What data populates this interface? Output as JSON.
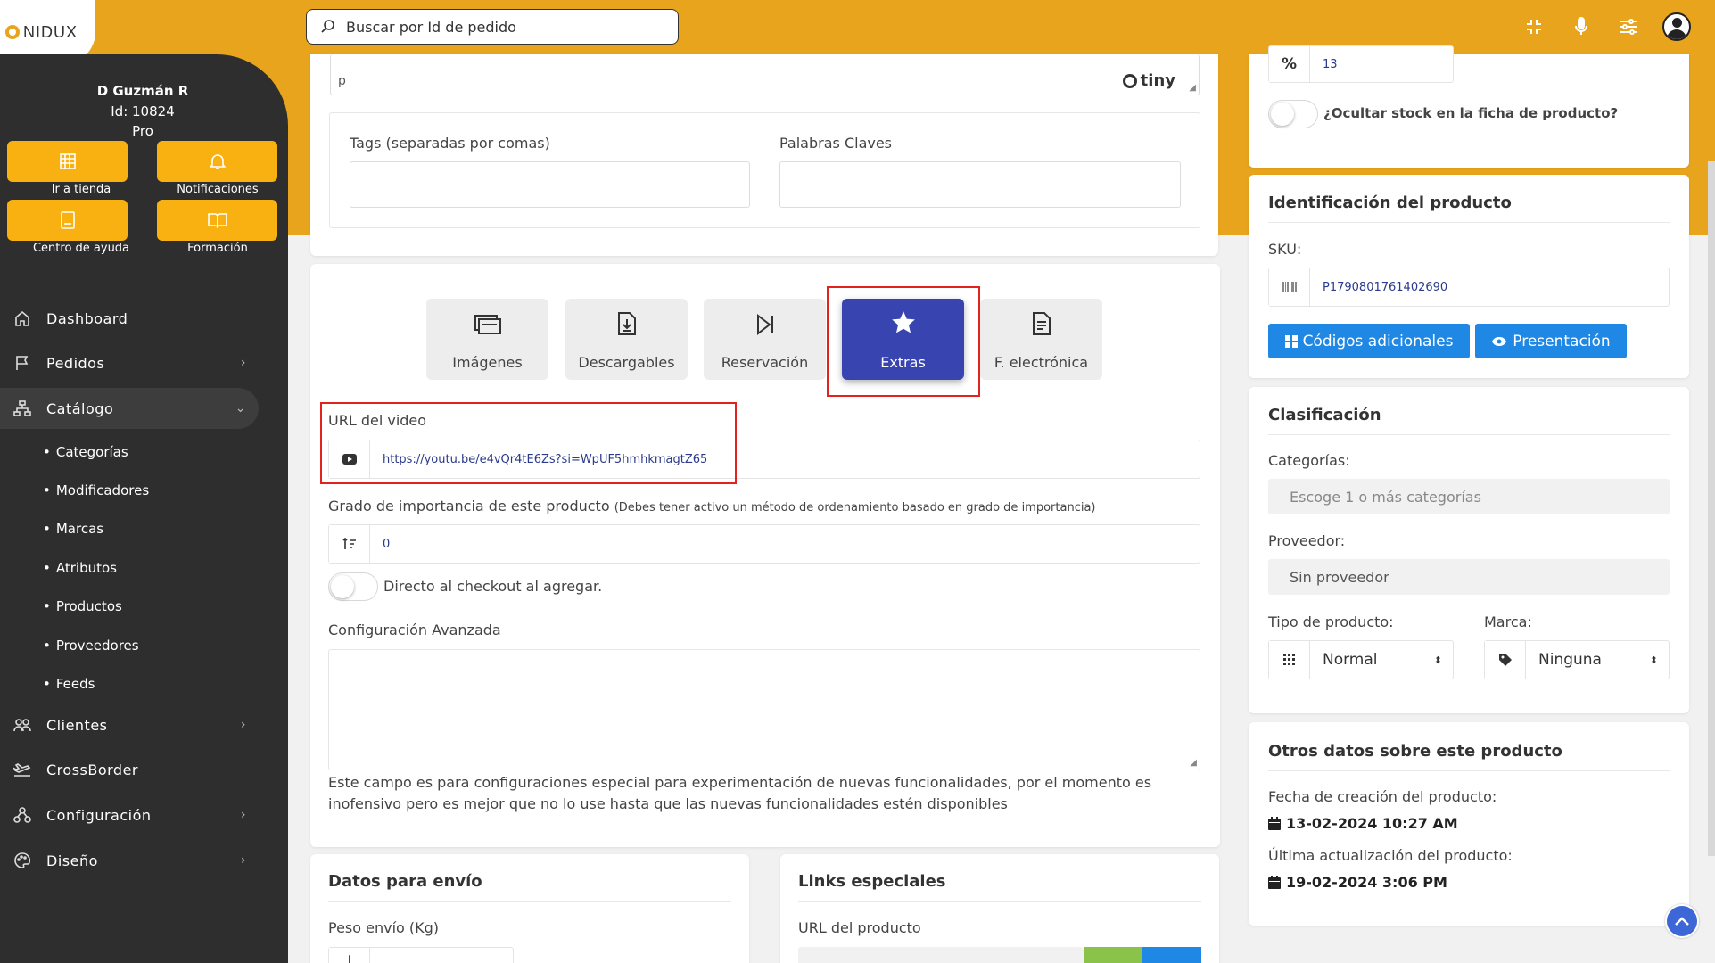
{
  "search": {
    "placeholder": "Buscar por Id de pedido"
  },
  "logo": {
    "text": "NIDUX"
  },
  "user": {
    "name": "D Guzmán R",
    "id": "Id: 10824",
    "plan": "Pro"
  },
  "quick_actions": [
    {
      "label": "Ir a tienda",
      "icon": "store-icon"
    },
    {
      "label": "Notificaciones",
      "icon": "bell-icon"
    },
    {
      "label": "Centro de ayuda",
      "icon": "book-icon"
    },
    {
      "label": "Formación",
      "icon": "open-book-icon"
    }
  ],
  "nav": {
    "dashboard": "Dashboard",
    "pedidos": "Pedidos",
    "catalogo": "Catálogo",
    "clientes": "Clientes",
    "crossborder": "CrossBorder",
    "configuracion": "Configuración",
    "diseno": "Diseño"
  },
  "catalog_sub": [
    "Categorías",
    "Modificadores",
    "Marcas",
    "Atributos",
    "Productos",
    "Proveedores",
    "Feeds"
  ],
  "editor": {
    "status": "p",
    "brand": "tiny"
  },
  "tags": {
    "tags_label": "Tags (separadas por comas)",
    "keywords_label": "Palabras Claves"
  },
  "tabs": [
    "Imágenes",
    "Descargables",
    "Reservación",
    "Extras",
    "F. electrónica"
  ],
  "extras": {
    "video_label": "URL del video",
    "video_value": "https://youtu.be/e4vQr4tE6Zs?si=WpUF5hmhkmagtZ65",
    "importance_label": "Grado de importancia de este producto",
    "importance_note": "(Debes tener activo un método de ordenamiento basado en grado de importancia)",
    "importance_value": "0",
    "checkout_label": "Directo al checkout al agregar.",
    "advanced_label": "Configuración Avanzada",
    "advanced_help": "Este campo es para configuraciones especial para experimentación de nuevas funcionalidades, por el momento es inofensivo pero es mejor que no lo use hasta que las nuevas funcionalidades estén disponibles"
  },
  "shipping": {
    "title": "Datos para envío",
    "weight_label": "Peso envío (Kg)"
  },
  "links": {
    "title": "Links especiales",
    "url_label": "URL del producto"
  },
  "stock": {
    "percent_symbol": "%",
    "percent_value": "13",
    "hide_stock_label": "¿Ocultar stock en la ficha de producto?"
  },
  "identification": {
    "title": "Identificación del producto",
    "sku_label": "SKU:",
    "sku_value": "P1790801761402690",
    "codes_button": "Códigos adicionales",
    "presentation_button": "Presentación"
  },
  "classification": {
    "title": "Clasificación",
    "categories_label": "Categorías:",
    "categories_placeholder": "Escoge 1 o más categorías",
    "provider_label": "Proveedor:",
    "provider_value": "Sin proveedor",
    "type_label": "Tipo de producto:",
    "type_value": "Normal",
    "brand_label": "Marca:",
    "brand_value": "Ninguna"
  },
  "other": {
    "title": "Otros datos sobre este producto",
    "created_label": "Fecha de creación del producto:",
    "created_value": "13-02-2024 10:27 AM",
    "updated_label": "Última actualización del producto:",
    "updated_value": "19-02-2024 3:06 PM"
  },
  "colors": {
    "brand": "#e8a41c",
    "sidebar": "#2e2e2e",
    "active_tab": "#3845b0",
    "button": "#1f88e5",
    "highlight": "#e0231b"
  }
}
